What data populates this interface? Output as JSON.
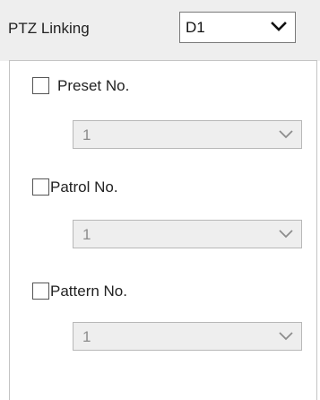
{
  "header": {
    "title": "PTZ Linking",
    "select_value": "D1"
  },
  "options": [
    {
      "label": "Preset No.",
      "checked": false,
      "value": "1"
    },
    {
      "label": "Patrol No.",
      "checked": false,
      "value": "1"
    },
    {
      "label": "Pattern No.",
      "checked": false,
      "value": "1"
    }
  ],
  "icons": {
    "dropdown": "chevron-down-icon"
  },
  "colors": {
    "header_bg": "#eeeeee",
    "disabled_select_bg": "#eeeeee",
    "disabled_text": "#8c8c8c"
  }
}
